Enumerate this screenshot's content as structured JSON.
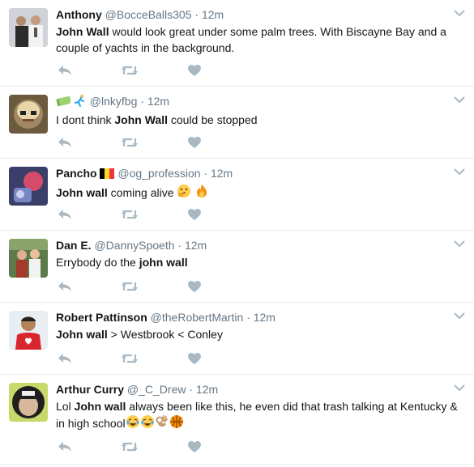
{
  "tweets": [
    {
      "name": "Anthony",
      "handle": "@BocceBalls305",
      "time": "12m",
      "pre": "",
      "bold": "John Wall",
      "post": " would look great under some palm trees. With Biscayne Bay and a couple of yachts in the background."
    },
    {
      "name": "",
      "handle": "@lnkyfbg",
      "time": "12m",
      "pre": "I dont think ",
      "bold": "John Wall",
      "post": " could be stopped"
    },
    {
      "name": "Pancho",
      "handle": "@og_profession",
      "time": "12m",
      "pre": "",
      "bold": "John wall",
      "post": " coming alive"
    },
    {
      "name": "Dan E.",
      "handle": "@DannySpoeth",
      "time": "12m",
      "pre": "Errybody do the ",
      "bold": "john wall",
      "post": ""
    },
    {
      "name": "Robert Pattinson",
      "handle": "@theRobertMartin",
      "time": "12m",
      "pre": "",
      "bold": "John wall",
      "post": " > Westbrook < Conley"
    },
    {
      "name": "Arthur Curry",
      "handle": "@_C_Drew",
      "time": "12m",
      "pre": "Lol ",
      "bold": "John wall",
      "post": " always been like this, he even did that trash talking at Kentucky & in high school"
    }
  ],
  "separator": "·",
  "icons": {
    "reply": "reply-icon",
    "retweet": "retweet-icon",
    "like": "heart-icon",
    "menu": "chevron-down-icon"
  },
  "colors": {
    "icon": "#aab8c2",
    "border": "#e6ecf0",
    "secondary": "#657786"
  }
}
